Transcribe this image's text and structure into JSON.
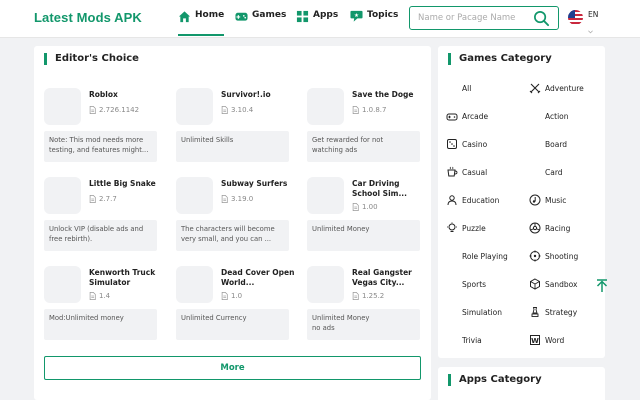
{
  "header": {
    "logo": "Latest Mods APK",
    "nav": [
      {
        "label": "Home",
        "icon": "home-icon",
        "active": true
      },
      {
        "label": "Games",
        "icon": "gamepad-icon"
      },
      {
        "label": "Apps",
        "icon": "apps-grid-icon"
      },
      {
        "label": "Topics",
        "icon": "topics-icon"
      }
    ],
    "search": {
      "placeholder": "Name or Pacage Name",
      "value": ""
    },
    "language": {
      "code": "EN",
      "flag": "us-flag-icon"
    }
  },
  "editors_choice": {
    "title": "Editor's Choice",
    "cards": [
      {
        "title": "Roblox",
        "version": "2.726.1142",
        "note": "Note: This mod needs more testing, and features might..."
      },
      {
        "title": "Survivor!.io",
        "version": "3.10.4",
        "note": "Unlimited Skills"
      },
      {
        "title": "Save the Doge",
        "version": "1.0.8.7",
        "note": "Get rewarded for not watching ads"
      },
      {
        "title": "Little Big Snake",
        "version": "2.7.7",
        "note": "Unlock VIP (disable ads and free rebirth)."
      },
      {
        "title": "Subway Surfers",
        "version": "3.19.0",
        "note": "The characters will become very small, and you can ..."
      },
      {
        "title": "Car Driving School Sim...",
        "version": "1.00",
        "note": "Unlimited Money"
      },
      {
        "title": "Kenworth Truck Simulator",
        "version": "1.4",
        "note": "Mod:Unlimited money"
      },
      {
        "title": "Dead Cover Open World...",
        "version": "1.0",
        "note": "Unlimited Currency"
      },
      {
        "title": "Real Gangster Vegas City...",
        "version": "1.25.2",
        "note": "Unlimited Money\nno ads"
      }
    ],
    "more_label": "More"
  },
  "games_category": {
    "title": "Games Category",
    "items": [
      {
        "label": "All",
        "icon": ""
      },
      {
        "label": "Adventure",
        "icon": "swords-icon"
      },
      {
        "label": "Arcade",
        "icon": "joystick-icon"
      },
      {
        "label": "Action",
        "icon": ""
      },
      {
        "label": "Casino",
        "icon": "dice-icon"
      },
      {
        "label": "Board",
        "icon": ""
      },
      {
        "label": "Casual",
        "icon": "cup-icon"
      },
      {
        "label": "Card",
        "icon": ""
      },
      {
        "label": "Education",
        "icon": "education-icon"
      },
      {
        "label": "Music",
        "icon": "music-icon"
      },
      {
        "label": "Puzzle",
        "icon": "bulb-icon"
      },
      {
        "label": "Racing",
        "icon": "wheel-icon"
      },
      {
        "label": "Role Playing",
        "icon": ""
      },
      {
        "label": "Shooting",
        "icon": "target-icon"
      },
      {
        "label": "Sports",
        "icon": ""
      },
      {
        "label": "Sandbox",
        "icon": "sandbox-icon"
      },
      {
        "label": "Simulation",
        "icon": ""
      },
      {
        "label": "Strategy",
        "icon": "chess-icon"
      },
      {
        "label": "Trivia",
        "icon": ""
      },
      {
        "label": "Word",
        "icon": "word-icon"
      }
    ]
  },
  "apps_category": {
    "title": "Apps Category"
  },
  "colors": {
    "accent": "#12976b",
    "background": "#f1f2f4"
  }
}
